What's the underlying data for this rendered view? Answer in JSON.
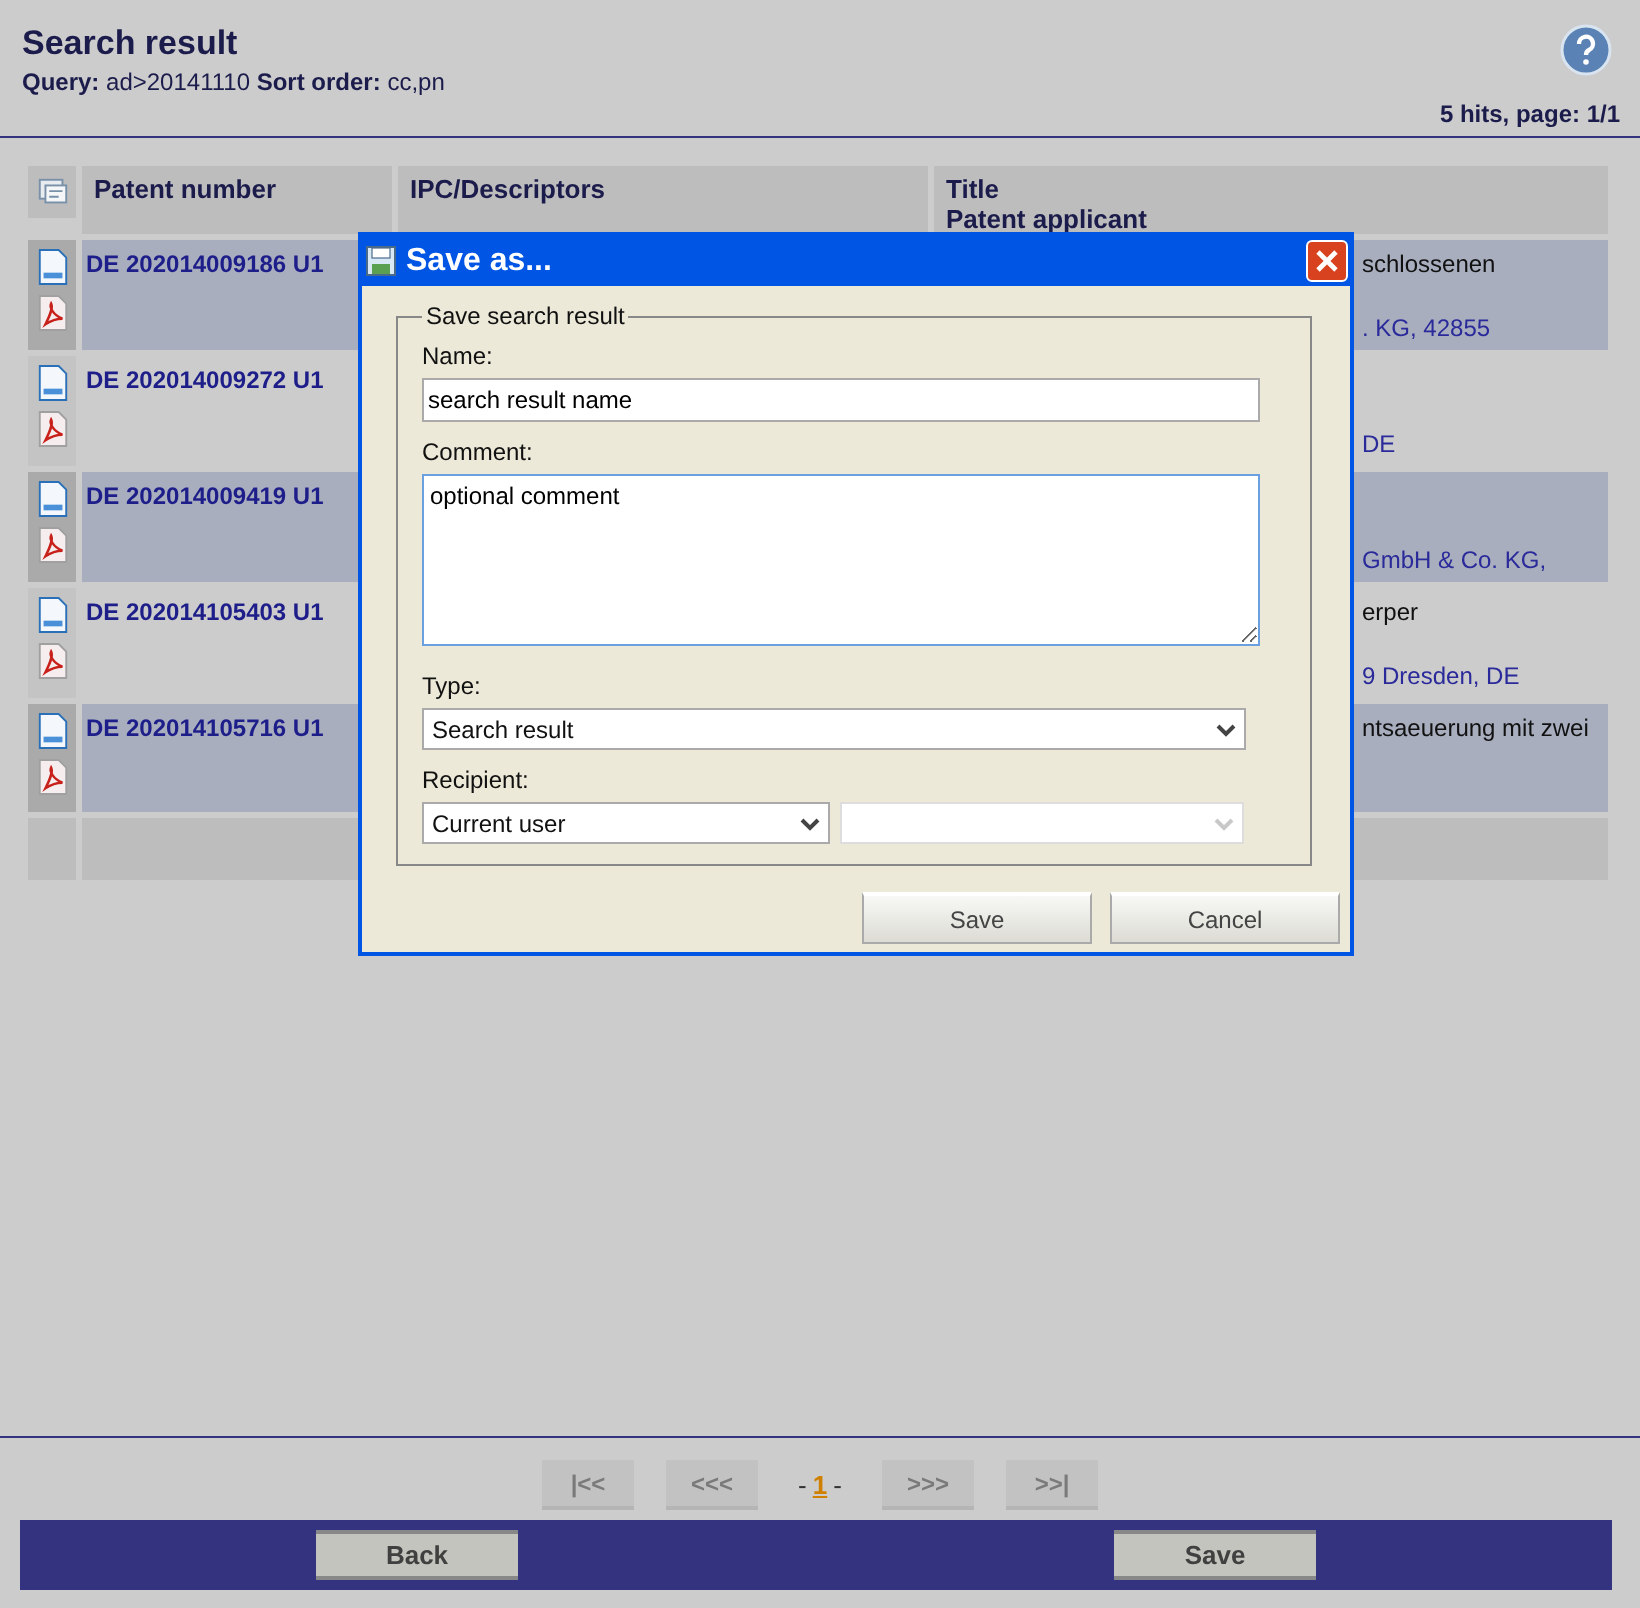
{
  "header": {
    "title": "Search result",
    "query_label": "Query:",
    "query": "ad>20141110",
    "sort_label": "Sort order:",
    "sort": "cc,pn",
    "hits": "5 hits, page: 1/1"
  },
  "table": {
    "columns": [
      {
        "label": "Patent number"
      },
      {
        "label": "IPC/Descriptors"
      },
      {
        "label": "Title",
        "sublabel": "Patent applicant"
      }
    ],
    "rows": [
      {
        "patent_number": "DE 202014009186 U1",
        "title": "schlossenen",
        "applicant": ". KG, 42855",
        "shaded": true
      },
      {
        "patent_number": "DE 202014009272 U1",
        "applicant": "DE",
        "shaded": false
      },
      {
        "patent_number": "DE 202014009419 U1",
        "applicant": "GmbH & Co. KG,",
        "shaded": true
      },
      {
        "patent_number": "DE 202014105403 U1",
        "title": "erper",
        "applicant": "9 Dresden, DE",
        "shaded": false
      },
      {
        "patent_number": "DE 202014105716 U1",
        "title": "ntsaeuerung mit zwei",
        "shaded": true
      }
    ]
  },
  "dialog": {
    "title": "Save as...",
    "group": "Save search result",
    "name_label": "Name:",
    "name_value": "search result name",
    "comment_label": "Comment:",
    "comment_value": "optional comment",
    "type_label": "Type:",
    "type_value": "Search result",
    "recipient_label": "Recipient:",
    "recipient": [
      {
        "value": "Current user",
        "disabled": false
      },
      {
        "disabled": true
      }
    ],
    "buttons": [
      "Save",
      "Cancel"
    ]
  },
  "pagination": {
    "buttons": [
      {
        "label": "|<<",
        "disabled": true
      },
      {
        "label": "<<<",
        "disabled": true
      },
      {
        "label": ">>>",
        "disabled": true
      },
      {
        "label": ">>|",
        "disabled": true
      }
    ],
    "current": "1",
    "separator": "-"
  },
  "footer": {
    "buttons": [
      "Back",
      "Save"
    ]
  }
}
